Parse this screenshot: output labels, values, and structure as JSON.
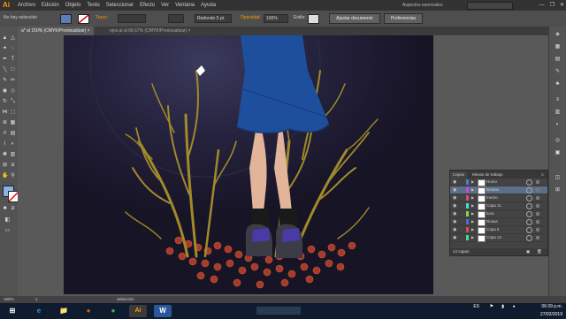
{
  "menubar": {
    "logo": "Ai",
    "menus": [
      "Archivo",
      "Edición",
      "Objeto",
      "Texto",
      "Seleccionar",
      "Efecto",
      "Ver",
      "Ventana",
      "Ayuda"
    ],
    "workspace": "Aspectos esenciales",
    "window_controls": [
      "—",
      "❐",
      "✕"
    ]
  },
  "control_bar": {
    "selection": "No hay selección",
    "stroke_label": "Trazo:",
    "brush_label": "Redondo 5 pt.",
    "opacity_label": "Opacidad:",
    "opacity_value": "100%",
    "style_label": "Estilo:",
    "doc_setup_button": "Ajustar documento",
    "preferences_button": "Preferencias"
  },
  "tabs": [
    {
      "label": "a* al 150% (CMYK/Previsualizar)",
      "close": "×"
    },
    {
      "label": "ojos.ai al 66,67% (CMYK/Previsualizar)",
      "close": "×"
    }
  ],
  "layers_panel": {
    "tabs": [
      "Capas",
      "Mesas de trabajo"
    ],
    "menu_icon": "≡",
    "rows": [
      {
        "name": "Humo",
        "color": "#4a7bd4"
      },
      {
        "name": "Brasas",
        "color": "#c04bd8"
      },
      {
        "name": "medro",
        "color": "#d84b7b"
      },
      {
        "name": "Capa 11",
        "color": "#4bd8d8"
      },
      {
        "name": "luna",
        "color": "#7bd84b"
      },
      {
        "name": "Rosas",
        "color": "#4b6bd8"
      },
      {
        "name": "Capa 6",
        "color": "#d84b4b"
      },
      {
        "name": "Capa 12",
        "color": "#4bd88a"
      }
    ],
    "footer_count": "14 capas"
  },
  "status": {
    "zoom": "150%",
    "page": "1",
    "mode": "Selección"
  },
  "taskbar": {
    "apps": [
      "e",
      "📁",
      "●",
      "●",
      "Ai",
      "W"
    ],
    "language": "ES",
    "time": "06:39 p.m.",
    "date": "27/02/2019"
  },
  "colors": {
    "accent_orange": "#ff9a00",
    "artboard": "#171426",
    "dress_blue": "#1e4f9c"
  }
}
